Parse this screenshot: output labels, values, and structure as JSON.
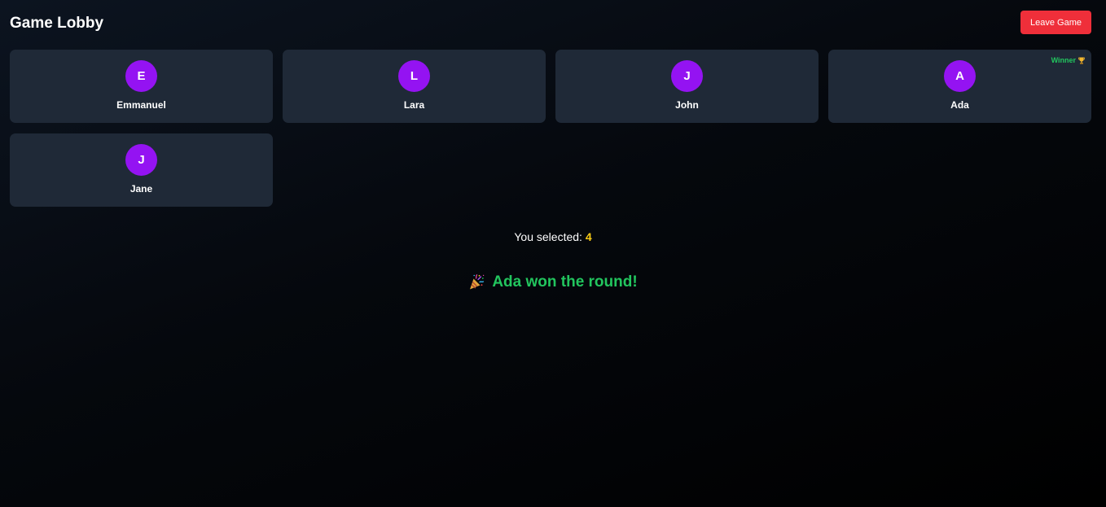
{
  "header": {
    "title": "Game Lobby",
    "leave_button_label": "Leave Game"
  },
  "players": [
    {
      "initial": "E",
      "name": "Emmanuel"
    },
    {
      "initial": "L",
      "name": "Lara"
    },
    {
      "initial": "J",
      "name": "John"
    },
    {
      "initial": "A",
      "name": "Ada",
      "winner_label": "Winner",
      "winner_icon": "trophy-icon"
    },
    {
      "initial": "J",
      "name": "Jane"
    }
  ],
  "selection": {
    "label": "You selected:",
    "value": "4"
  },
  "result": {
    "icon": "party-popper-icon",
    "message": "Ada won the round!"
  },
  "colors": {
    "avatar": "#9413f2",
    "card": "#1f2937",
    "leave_button": "#ef2f3a",
    "winner": "#22c55e",
    "selected_value": "#facc15"
  }
}
